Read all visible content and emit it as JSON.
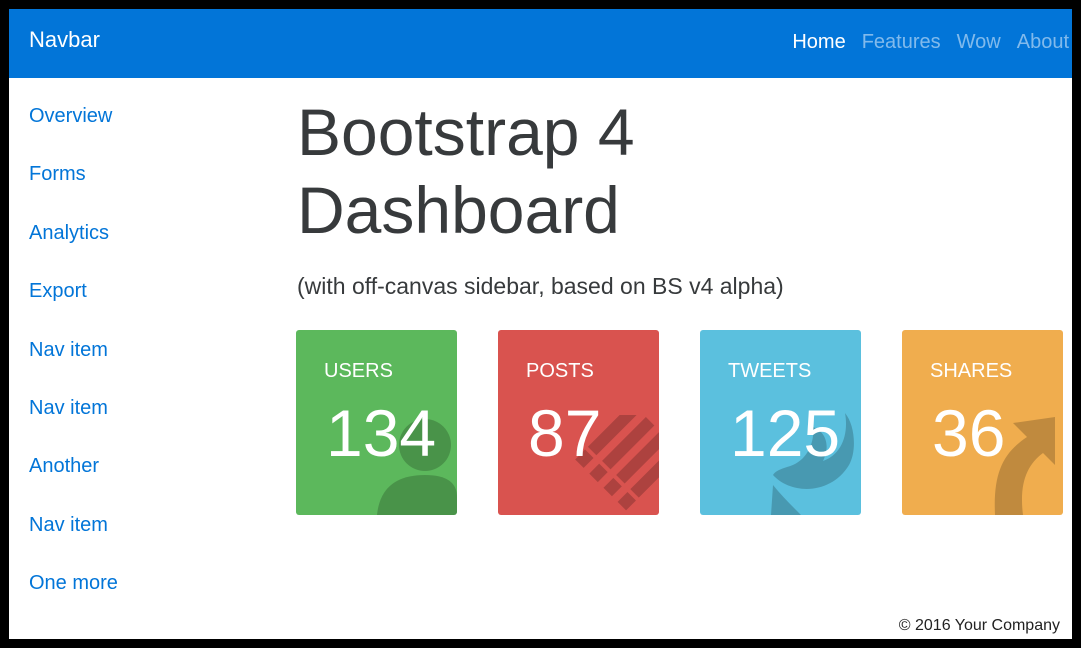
{
  "navbar": {
    "brand": "Navbar",
    "links": [
      {
        "label": "Home",
        "active": true
      },
      {
        "label": "Features",
        "active": false
      },
      {
        "label": "Wow",
        "active": false
      },
      {
        "label": "About",
        "active": false
      }
    ]
  },
  "sidebar": {
    "items": [
      {
        "label": "Overview"
      },
      {
        "label": "Forms"
      },
      {
        "label": "Analytics"
      },
      {
        "label": "Export"
      },
      {
        "label": "Nav item"
      },
      {
        "label": "Nav item"
      },
      {
        "label": "Another"
      },
      {
        "label": "Nav item"
      },
      {
        "label": "One more"
      }
    ]
  },
  "main": {
    "title": "Bootstrap 4 Dashboard",
    "subtitle": "(with off-canvas sidebar, based on BS v4 alpha)",
    "cards": [
      {
        "label": "USERS",
        "count": "134",
        "color": "#5cb85c",
        "icon": "user-icon"
      },
      {
        "label": "POSTS",
        "count": "87",
        "color": "#d9534f",
        "icon": "list-icon"
      },
      {
        "label": "TWEETS",
        "count": "125",
        "color": "#5bc0de",
        "icon": "twitter-icon"
      },
      {
        "label": "SHARES",
        "count": "36",
        "color": "#f0ad4e",
        "icon": "share-icon"
      }
    ]
  },
  "footer": {
    "text": "© 2016 Your Company"
  },
  "colors": {
    "primary": "#0275d8",
    "text": "#373a3c"
  }
}
